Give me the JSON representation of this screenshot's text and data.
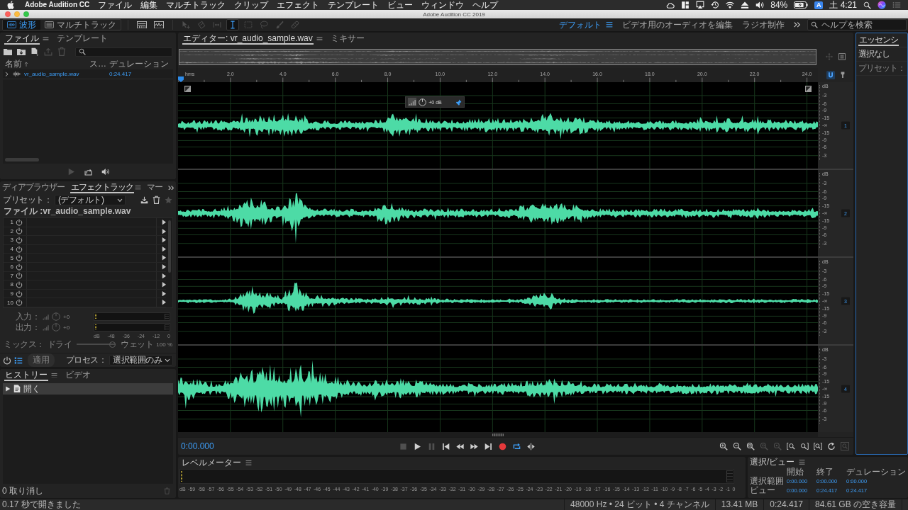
{
  "menubar": {
    "app": "Adobe Audition CC",
    "menus": [
      "ファイル",
      "編集",
      "マルチトラック",
      "クリップ",
      "エフェクト",
      "テンプレート",
      "ビュー",
      "ウィンドウ",
      "ヘルプ"
    ],
    "battery": "84%",
    "input_source": "A",
    "clock": "土 4:21"
  },
  "window": {
    "title": "Adobe Audition CC 2019"
  },
  "toolbar": {
    "views": [
      {
        "label": "波形",
        "kind": "waveform",
        "selected": true
      },
      {
        "label": "マルチトラック",
        "kind": "multitrack",
        "selected": false
      }
    ],
    "displays": [
      {
        "kind": "spectral-frequency",
        "disabled": false
      },
      {
        "kind": "spectral-pitch",
        "disabled": false
      }
    ],
    "tools": [
      {
        "kind": "move",
        "selected": false,
        "disabled": true
      },
      {
        "kind": "razor",
        "selected": false,
        "disabled": true
      },
      {
        "kind": "slip",
        "selected": false,
        "disabled": true
      },
      {
        "kind": "time-selection",
        "selected": true,
        "disabled": false
      },
      {
        "kind": "marquee",
        "selected": false,
        "disabled": true
      },
      {
        "kind": "lasso",
        "selected": false,
        "disabled": true
      },
      {
        "kind": "brush",
        "selected": false,
        "disabled": true
      },
      {
        "kind": "healing",
        "selected": false,
        "disabled": true
      }
    ],
    "workspaces": [
      {
        "label": "デフォルト",
        "selected": true
      },
      {
        "label": "ビデオ用のオーディオを編集",
        "selected": false
      },
      {
        "label": "ラジオ制作",
        "selected": false
      }
    ],
    "help_search": {
      "placeholder": "ヘルプを検索"
    }
  },
  "files": {
    "tabs": [
      {
        "label": "ファイル",
        "selected": true
      },
      {
        "label": "テンプレート",
        "selected": false
      }
    ],
    "tools": [
      {
        "kind": "open",
        "disabled": false
      },
      {
        "kind": "import",
        "disabled": false
      },
      {
        "kind": "new",
        "disabled": false
      },
      {
        "kind": "export",
        "disabled": true
      },
      {
        "kind": "delete",
        "disabled": true
      }
    ],
    "columns": [
      "名前",
      "ス…",
      "デュレーション"
    ],
    "rows": [
      {
        "name": "vr_audio_sample.wav",
        "duration": "0:24.417",
        "expanded": false
      }
    ],
    "footer": [
      {
        "kind": "play",
        "disabled": true
      },
      {
        "kind": "loop",
        "disabled": false
      },
      {
        "kind": "autoplay",
        "disabled": false
      }
    ]
  },
  "rack": {
    "tabs": [
      {
        "label": "ディアブラウザー",
        "selected": false
      },
      {
        "label": "エフェクトラック",
        "selected": true
      },
      {
        "label": "マー",
        "selected": false
      }
    ],
    "preset": {
      "label": "プリセット：",
      "value": "(デフォルト)"
    },
    "preset_tools": [
      {
        "kind": "save",
        "disabled": false
      },
      {
        "kind": "delete",
        "disabled": false
      },
      {
        "kind": "favorite",
        "disabled": true
      }
    ],
    "file": "ファイル :vr_audio_sample.wav",
    "slots": [
      {
        "number": "1"
      },
      {
        "number": "2"
      },
      {
        "number": "3"
      },
      {
        "number": "4"
      },
      {
        "number": "5"
      },
      {
        "number": "6"
      },
      {
        "number": "7"
      },
      {
        "number": "8"
      },
      {
        "number": "9"
      },
      {
        "number": "10"
      }
    ],
    "input": {
      "label": "入力：",
      "value": "+0",
      "disabled": true
    },
    "output": {
      "label": "出力：",
      "value": "+0",
      "disabled": true
    },
    "meter_scale": [
      "dB",
      "-48",
      "-36",
      "-24",
      "-12",
      "0"
    ],
    "mix": {
      "label": "ミックス：",
      "dry": "ドライ",
      "wet": "ウェット",
      "value": "100 %",
      "level": 1,
      "disabled": true
    },
    "list_view": {
      "on": true
    },
    "apply": {
      "label": "適用",
      "disabled": true
    },
    "process": {
      "label": "プロセス：",
      "value": "選択範囲のみ"
    }
  },
  "history": {
    "tabs": [
      {
        "label": "ヒストリー",
        "selected": true
      },
      {
        "label": "ビデオ",
        "selected": false
      }
    ],
    "items": [
      {
        "label": "開く",
        "selected": true
      }
    ],
    "undo": "0 取り消し",
    "delete": {
      "disabled": true
    }
  },
  "editor": {
    "tabs": [
      {
        "label": "エディター: vr_audio_sample.wav",
        "selected": true
      },
      {
        "label": "ミキサー",
        "selected": false
      }
    ],
    "ruler": [
      "hms",
      "2.0",
      "4.0",
      "6.0",
      "8.0",
      "10.0",
      "12.0",
      "14.0",
      "16.0",
      "18.0",
      "20.0",
      "22.0",
      "24.0"
    ],
    "channels": [
      {
        "number": "1",
        "scale": [
          "dB",
          "-3",
          "-6",
          "-9",
          "-15",
          "-∞",
          "-15",
          "-9",
          "-6",
          "-3"
        ]
      },
      {
        "number": "2",
        "scale": [
          "dB",
          "-3",
          "-6",
          "-9",
          "-15",
          "-∞",
          "-15",
          "-9",
          "-6",
          "-3"
        ]
      },
      {
        "number": "3",
        "scale": [
          "dB",
          "-3",
          "-6",
          "-9",
          "-15",
          "-∞",
          "-15",
          "-9",
          "-6",
          "-3"
        ]
      },
      {
        "number": "4",
        "scale": [
          "dB",
          "-3",
          "-6",
          "-9",
          "-15",
          "-∞",
          "-15",
          "-9",
          "-6",
          "-3"
        ]
      }
    ],
    "hud": {
      "gain": "+0 dB"
    },
    "time": "0:00.000",
    "transport": [
      {
        "kind": "stop",
        "disabled": true,
        "on": false
      },
      {
        "kind": "play",
        "disabled": false,
        "on": false
      },
      {
        "kind": "pause",
        "disabled": true,
        "on": false
      },
      {
        "kind": "to-start",
        "disabled": false,
        "on": false
      },
      {
        "kind": "rewind",
        "disabled": false,
        "on": false
      },
      {
        "kind": "fast-forward",
        "disabled": false,
        "on": false
      },
      {
        "kind": "to-end",
        "disabled": false,
        "on": false
      },
      {
        "kind": "record",
        "disabled": false,
        "on": false
      },
      {
        "kind": "loop",
        "disabled": false,
        "on": true
      },
      {
        "kind": "skip",
        "disabled": false,
        "on": false
      }
    ],
    "zoom": [
      {
        "kind": "zoom-in-amplitude",
        "disabled": false
      },
      {
        "kind": "zoom-out-amplitude",
        "disabled": false
      },
      {
        "kind": "zoom-out-full",
        "disabled": false
      },
      {
        "kind": "zoom-in",
        "disabled": true
      },
      {
        "kind": "zoom-selection",
        "disabled": true
      },
      {
        "kind": "zoom-in-point",
        "disabled": false
      },
      {
        "kind": "zoom-out-point",
        "disabled": false
      },
      {
        "kind": "zoom-both",
        "disabled": false
      },
      {
        "kind": "zoom-rotate",
        "disabled": false
      },
      {
        "kind": "zoom-fit",
        "disabled": true
      }
    ]
  },
  "level_meter": {
    "title": "レベルメーター",
    "scale": [
      "dB",
      "-59",
      "-58",
      "-57",
      "-56",
      "-55",
      "-54",
      "-53",
      "-52",
      "-51",
      "-50",
      "-49",
      "-48",
      "-47",
      "-46",
      "-45",
      "-44",
      "-43",
      "-42",
      "-41",
      "-40",
      "-39",
      "-38",
      "-37",
      "-36",
      "-35",
      "-34",
      "-33",
      "-32",
      "-31",
      "-30",
      "-29",
      "-28",
      "-27",
      "-26",
      "-25",
      "-24",
      "-23",
      "-22",
      "-21",
      "-20",
      "-19",
      "-18",
      "-17",
      "-16",
      "-15",
      "-14",
      "-13",
      "-12",
      "-11",
      "-10",
      "-9",
      "-8",
      "-7",
      "-6",
      "-5",
      "-4",
      "-3",
      "-2",
      "-1",
      "0"
    ]
  },
  "selection_view": {
    "title": "選択/ビュー",
    "columns": [
      "開始",
      "終了",
      "デュレーション"
    ],
    "rows": [
      {
        "label": "選択範囲",
        "values": [
          "0:00.000",
          "0:00.000",
          "0:00.000"
        ]
      },
      {
        "label": "ビュー",
        "values": [
          "0:00.000",
          "0:24.417",
          "0:24.417"
        ]
      }
    ]
  },
  "essential": {
    "tabs": [
      {
        "label": "エッセンシ",
        "selected": true
      }
    ],
    "selection": "選択なし",
    "preset": {
      "label": "プリセット：",
      "disabled": true
    }
  },
  "status_bar": {
    "message": "0.17 秒で開きました",
    "items": [
      "48000 Hz • 24 ビット • 4 チャンネル",
      "13.41 MB",
      "0:24.417",
      "84.61 GB の空き容量"
    ]
  }
}
